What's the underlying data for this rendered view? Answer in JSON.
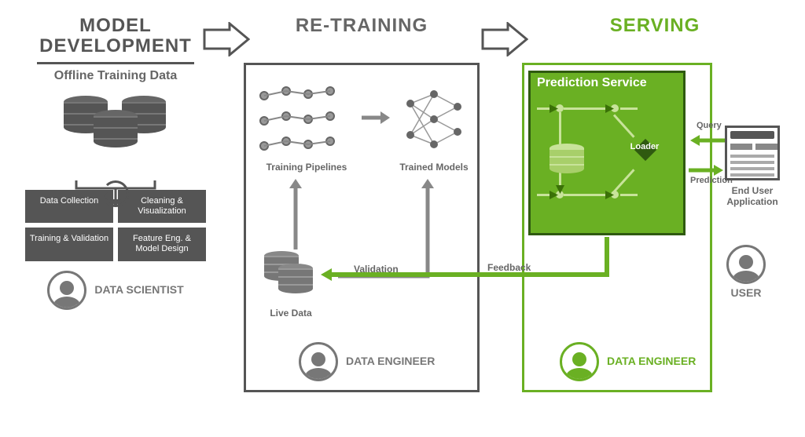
{
  "stages": {
    "model_dev": {
      "title_l1": "MODEL",
      "title_l2": "DEVELOPMENT",
      "subtitle": "Offline Training Data",
      "boxes": [
        "Data Collection",
        "Cleaning & Visualization",
        "Training & Validation",
        "Feature Eng. & Model Design"
      ],
      "persona": "DATA SCIENTIST"
    },
    "retraining": {
      "title": "RE-TRAINING",
      "labels": {
        "training_pipelines": "Training Pipelines",
        "trained_models": "Trained Models",
        "validation": "Validation",
        "live_data": "Live Data"
      },
      "persona": "DATA ENGINEER"
    },
    "serving": {
      "title": "SERVING",
      "prediction_service": "Prediction Service",
      "labels": {
        "loader": "Loader",
        "query": "Query",
        "prediction": "Prediction",
        "feedback": "Feedback",
        "end_user_app": "End User Application"
      },
      "persona_engineer": "DATA ENGINEER",
      "persona_user": "USER"
    }
  },
  "colors": {
    "gray": "#555555",
    "green": "#6ab023",
    "dark_green": "#2f5a10"
  }
}
